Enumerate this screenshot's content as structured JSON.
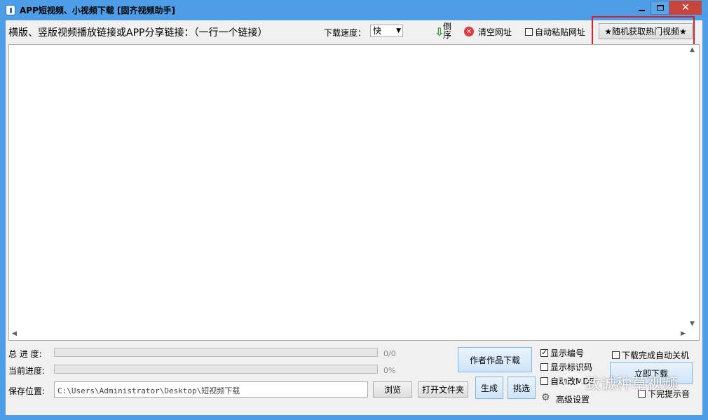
{
  "window": {
    "title": "APP短视频、小视频下载 [固齐视频助手]",
    "close_glyph": "✕"
  },
  "toolbar": {
    "hint": "横版、竖版视频播放链接或APP分享链接：（一行一个链接）",
    "speed_label": "下载速度：",
    "speed_value": "快",
    "reverse_label": "倒序",
    "clear_label": "清空网址",
    "auto_paste_label": "自动粘贴网址",
    "auto_paste_checked": false,
    "hot_button_label": "★随机获取热门视频★"
  },
  "url_area": {
    "value": ""
  },
  "progress": {
    "total_label": "总 进 度:",
    "total_text": "0/0",
    "total_fraction": 0,
    "current_label": "当前进度:",
    "current_text": "0%",
    "current_fraction": 0
  },
  "save": {
    "label": "保存位置:",
    "path": "C:\\Users\\Administrator\\Desktop\\短视频下载",
    "browse_label": "浏览",
    "open_folder_label": "打开文件夹"
  },
  "actions": {
    "author_download_label": "作者作品下载",
    "generate_label": "生成",
    "pick_label": "挑选",
    "start_download_label": "立即下载",
    "advanced_label": "高级设置"
  },
  "options": {
    "show_number_label": "显示编号",
    "show_number_checked": true,
    "show_id_label": "显示标识码",
    "show_id_checked": false,
    "auto_md5_label": "自动改MD5",
    "auto_md5_checked": false,
    "auto_shutdown_label": "下载完成自动关机",
    "auto_shutdown_checked": false,
    "done_sound_label": "下完提示音",
    "done_sound_checked": false
  },
  "watermark": {
    "text": "致诚种草视频"
  },
  "colors": {
    "title_bar": "#4d9ee6",
    "close_button": "#c7463c",
    "highlight_box": "#e21b2b",
    "progress_fill": "#06b025"
  }
}
